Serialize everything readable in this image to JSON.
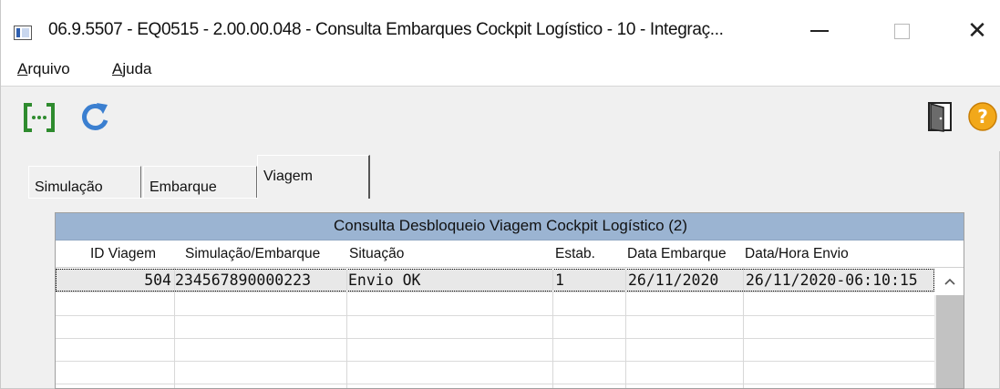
{
  "window": {
    "title": "06.9.5507 - EQ0515 - 2.00.00.048 - Consulta Embarques Cockpit Logístico - 10 - Integraç...",
    "minimize_glyph": "—",
    "close_glyph": "✕"
  },
  "menu": {
    "items": [
      {
        "first": "A",
        "rest": "rquivo"
      },
      {
        "first": "A",
        "rest": "juda"
      }
    ]
  },
  "toolbar": {
    "icons": [
      "bracket-ellipsis-icon",
      "refresh-icon",
      "exit-door-icon",
      "help-icon"
    ],
    "colors": {
      "green": "#2e8b2e",
      "blue": "#3b7fd0",
      "help": "#f2a81a"
    }
  },
  "tabs": [
    {
      "label": "Simulação",
      "active": false
    },
    {
      "label": "Embarque",
      "active": false
    },
    {
      "label": "Viagem",
      "active": true
    }
  ],
  "grid": {
    "title": "Consulta Desbloqueio Viagem Cockpit Logístico (2)",
    "title_color": "#9bb4d2",
    "columns": [
      "ID Viagem",
      "Simulação/Embarque",
      "Situação",
      "Estab.",
      "Data Embarque",
      "Data/Hora Envio"
    ],
    "rows": [
      [
        "504",
        "234567890000223",
        "Envio OK",
        "1",
        "26/11/2020",
        "26/11/2020-06:10:15"
      ]
    ]
  }
}
